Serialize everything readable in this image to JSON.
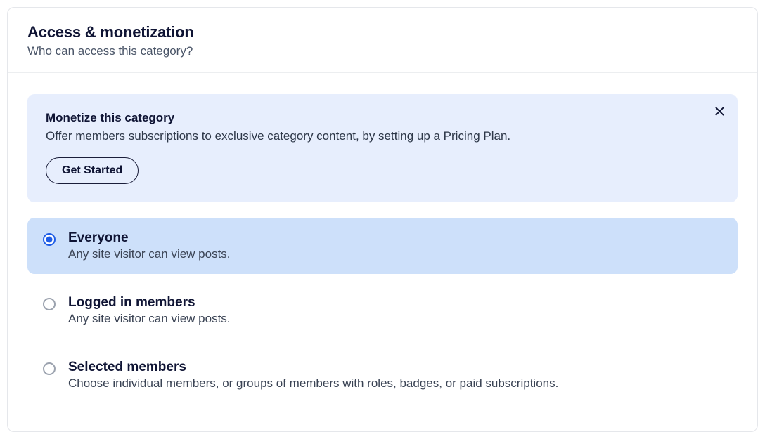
{
  "header": {
    "title": "Access & monetization",
    "subtitle": "Who can access this category?"
  },
  "banner": {
    "title": "Monetize this category",
    "description": "Offer members subscriptions to exclusive category content, by setting up a Pricing Plan.",
    "button_label": "Get Started"
  },
  "options": [
    {
      "title": "Everyone",
      "description": "Any site visitor can view posts.",
      "selected": true
    },
    {
      "title": "Logged in members",
      "description": "Any site visitor can view posts.",
      "selected": false
    },
    {
      "title": "Selected members",
      "description": "Choose individual members, or groups of members with roles, badges, or paid subscriptions.",
      "selected": false
    }
  ]
}
